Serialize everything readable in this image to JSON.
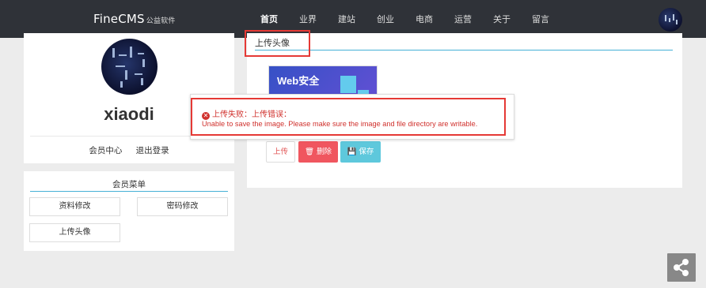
{
  "brand": {
    "name": "FineCMS",
    "sub": "公益软件"
  },
  "nav": [
    {
      "label": "首页",
      "active": true
    },
    {
      "label": "业界"
    },
    {
      "label": "建站"
    },
    {
      "label": "创业"
    },
    {
      "label": "电商"
    },
    {
      "label": "运营"
    },
    {
      "label": "关于"
    },
    {
      "label": "留言"
    }
  ],
  "profile": {
    "username": "xiaodi",
    "link_member_center": "会员中心",
    "link_logout": "退出登录"
  },
  "member_menu": {
    "title": "会员菜单",
    "edit_profile": "资料修改",
    "change_password": "密码修改",
    "upload_avatar": "上传头像"
  },
  "upload_panel": {
    "title": "上传头像",
    "preview_text": "Web安全",
    "upload_label": "上传",
    "delete_label": "删除",
    "save_label": "保存"
  },
  "error": {
    "title": "上传失败：上传错误：",
    "message": "Unable to save the image. Please make sure the image and file directory are writable."
  },
  "colors": {
    "nav_bg": "#2f3238",
    "accent_line": "#45b0d6",
    "error": "#d0312d",
    "delete_btn": "#f0565f",
    "save_btn": "#5ec8dc",
    "annotation": "#e53935"
  },
  "icons": {
    "delete": "trash-icon",
    "save": "floppy-disk-icon",
    "share": "share-icon",
    "error": "error-circle-icon"
  }
}
